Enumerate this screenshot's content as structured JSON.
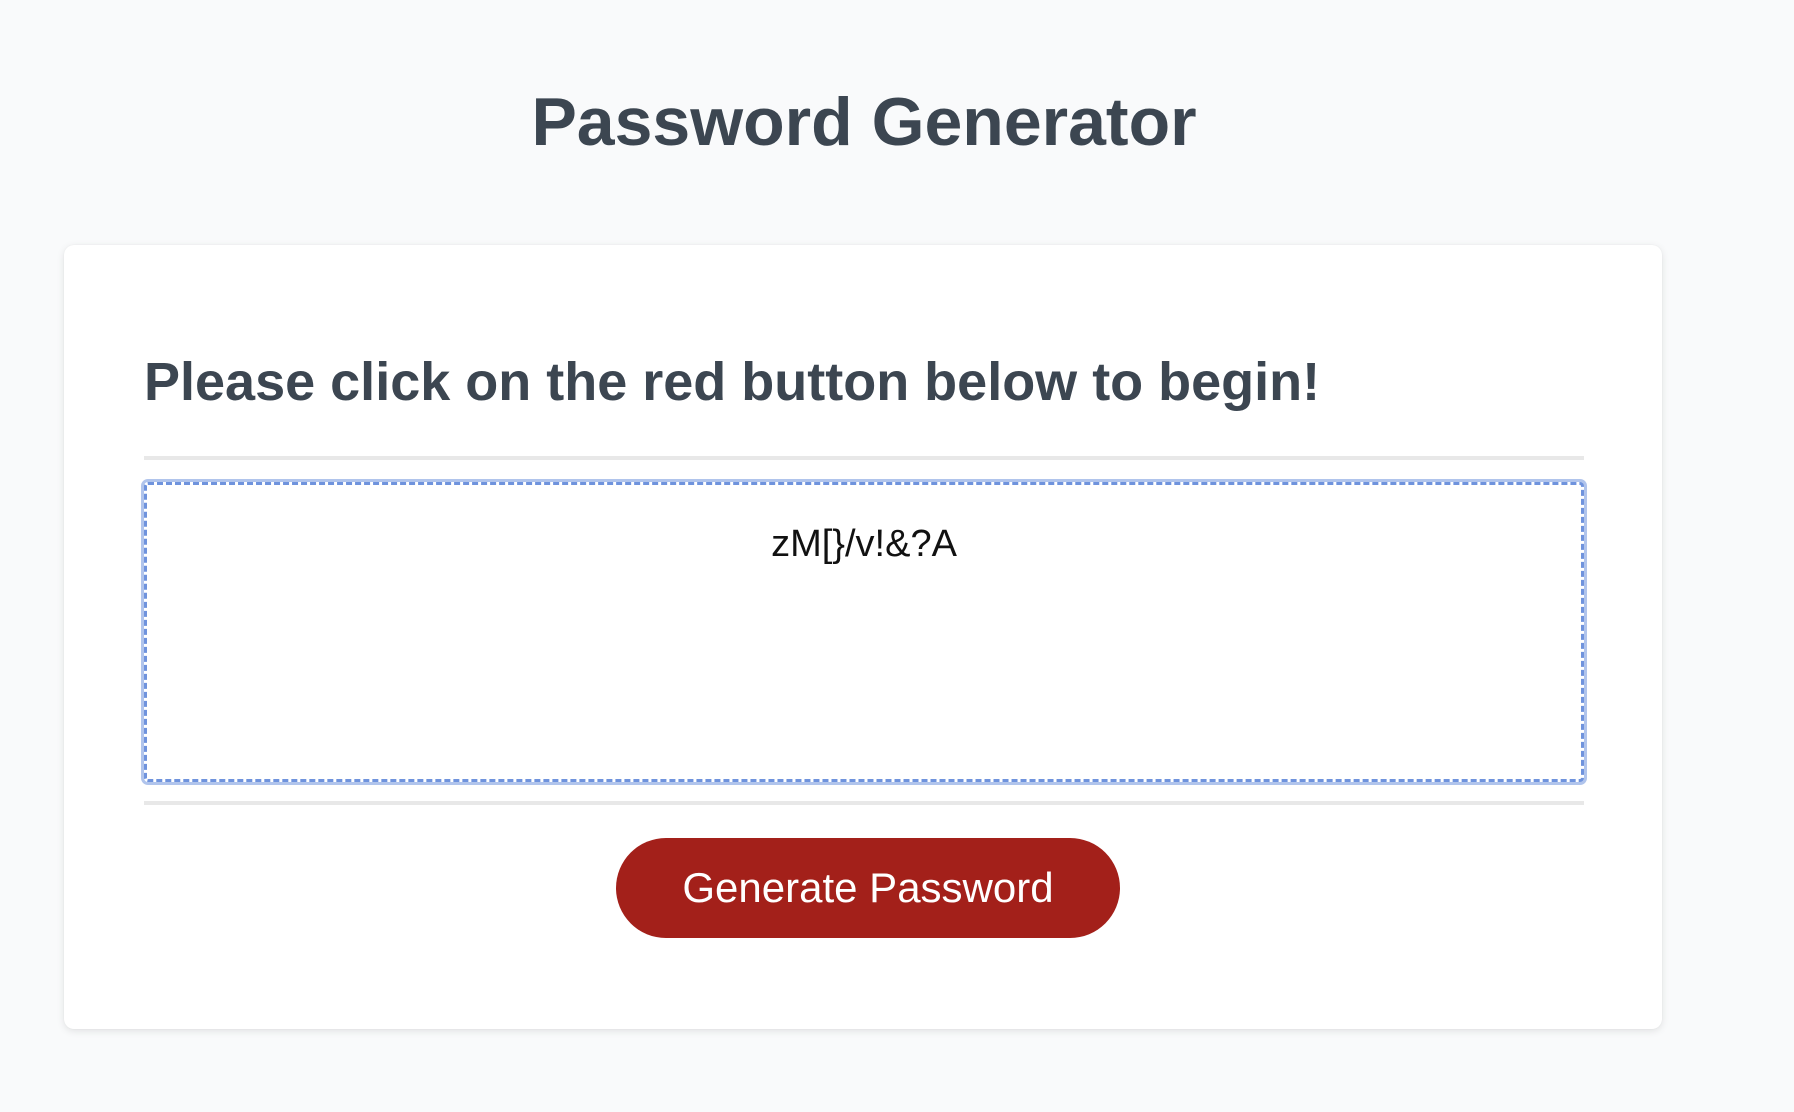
{
  "header": {
    "title": "Password Generator"
  },
  "card": {
    "heading": "Please click on the red button below to begin!",
    "password_value": "zM[}/v!&?A",
    "generate_button_label": "Generate Password"
  },
  "colors": {
    "page_background": "#f9fafb",
    "heading_text": "#3c4651",
    "button_background": "#a3201a",
    "focus_border": "#6f93dd"
  }
}
